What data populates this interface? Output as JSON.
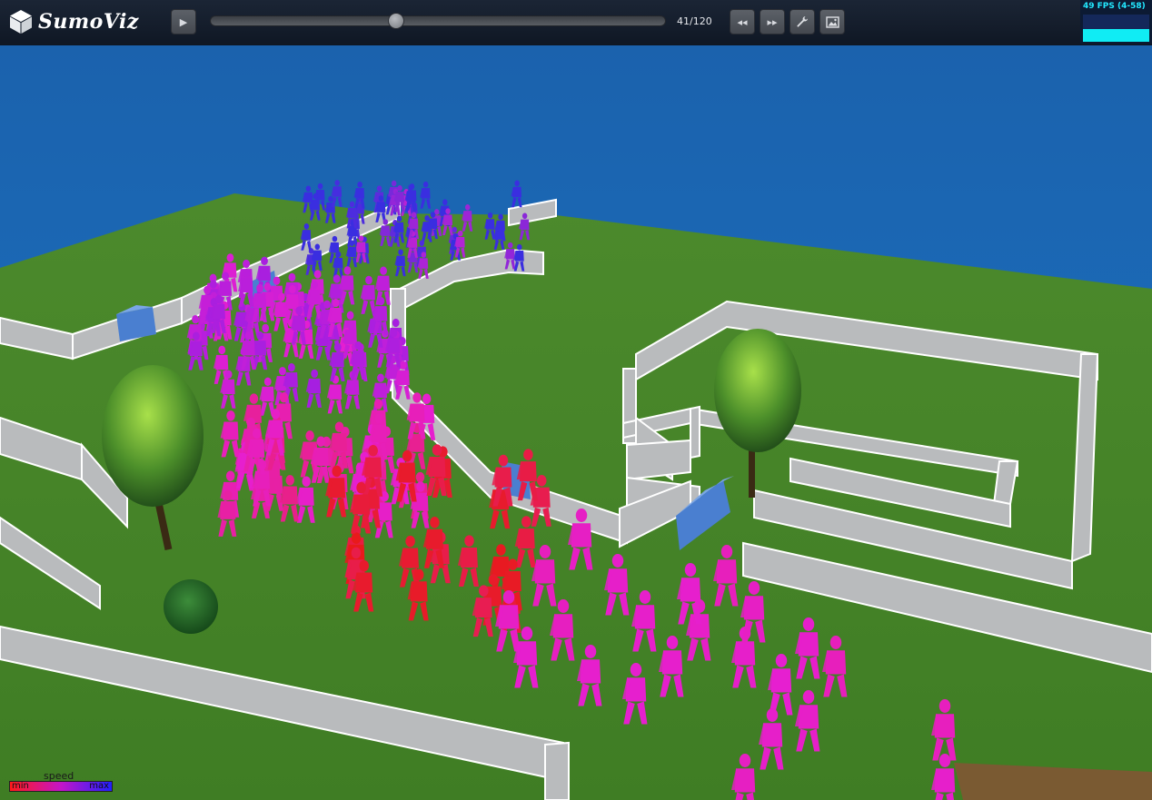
{
  "app": {
    "name": "SumoViz",
    "logo_icon": "cube-icon"
  },
  "toolbar": {
    "play_icon": "▶",
    "rewind_icon": "◂◂",
    "forward_icon": "▸▸",
    "settings_icon": "wrench",
    "screenshot_icon": "image",
    "frame_counter": "41/120",
    "current_frame": 41,
    "total_frames": 120
  },
  "stats": {
    "fps_text": "49 FPS (4-58)",
    "fps_value": 49,
    "fps_min": 4,
    "fps_max": 58
  },
  "legend": {
    "title": "speed",
    "min_label": "min",
    "max_label": "max",
    "colors": [
      "#ff1a1a",
      "#c415c8",
      "#2020ff"
    ]
  },
  "scene": {
    "sky_color": "#1a6bb5",
    "grass_color": "#4a8a2a",
    "wall_color": "#b9bbbd",
    "obstacle_color": "#4a7fd0"
  }
}
